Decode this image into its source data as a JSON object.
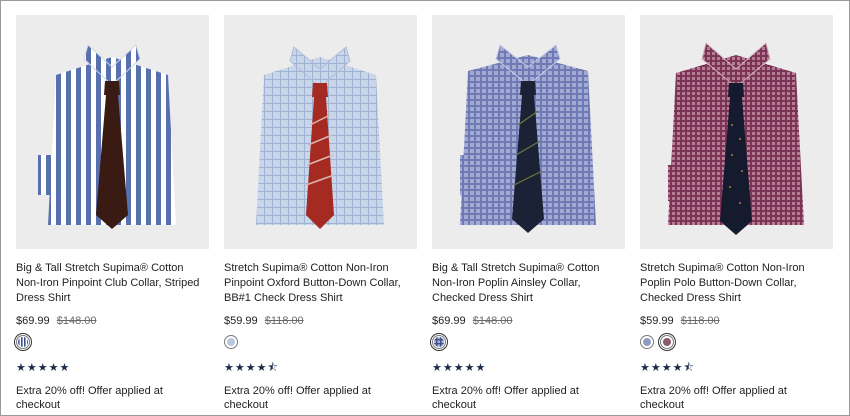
{
  "products": [
    {
      "title": "Big & Tall Stretch Supima® Cotton Non-Iron Pinpoint Club Collar, Striped Dress Shirt",
      "sale_price": "$69.99",
      "original_price": "$148.00",
      "swatches": [
        {
          "color": "#3c4f8a",
          "pattern": "stripe",
          "selected": true
        }
      ],
      "rating": "★★★★★",
      "offer": "Extra 20% off! Offer applied at checkout",
      "shirt_color": "#6e86bd",
      "tie_color": "#3a1b14"
    },
    {
      "title": "Stretch Supima® Cotton Non-Iron Pinpoint Oxford Button-Down Collar, BB#1 Check Dress Shirt",
      "sale_price": "$59.99",
      "original_price": "$118.00",
      "swatches": [
        {
          "color": "#b7c7dc",
          "pattern": "solid",
          "selected": false
        }
      ],
      "rating": "★★★★⯪",
      "offer": "Extra 20% off! Offer applied at checkout",
      "shirt_color": "#b9c9e0",
      "tie_color": "#a52b22"
    },
    {
      "title": "Big & Tall Stretch Supima® Cotton Non-Iron Poplin Ainsley Collar, Checked Dress Shirt",
      "sale_price": "$69.99",
      "original_price": "$148.00",
      "swatches": [
        {
          "color": "#5b6fa4",
          "pattern": "check",
          "selected": true
        }
      ],
      "rating": "★★★★★",
      "offer": "Extra 20% off! Offer applied at checkout",
      "shirt_color": "#8893c2",
      "tie_color": "#1b2236"
    },
    {
      "title": "Stretch Supima® Cotton Non-Iron Poplin Polo Button-Down Collar, Checked Dress Shirt",
      "sale_price": "$59.99",
      "original_price": "$118.00",
      "swatches": [
        {
          "color": "#8d9bc5",
          "pattern": "solid",
          "selected": false
        },
        {
          "color": "#8a5a6c",
          "pattern": "solid",
          "selected": true
        }
      ],
      "rating": "★★★★⯪",
      "offer": "Extra 20% off! Offer applied at checkout",
      "shirt_color": "#8e4f69",
      "tie_color": "#151a2e"
    }
  ]
}
